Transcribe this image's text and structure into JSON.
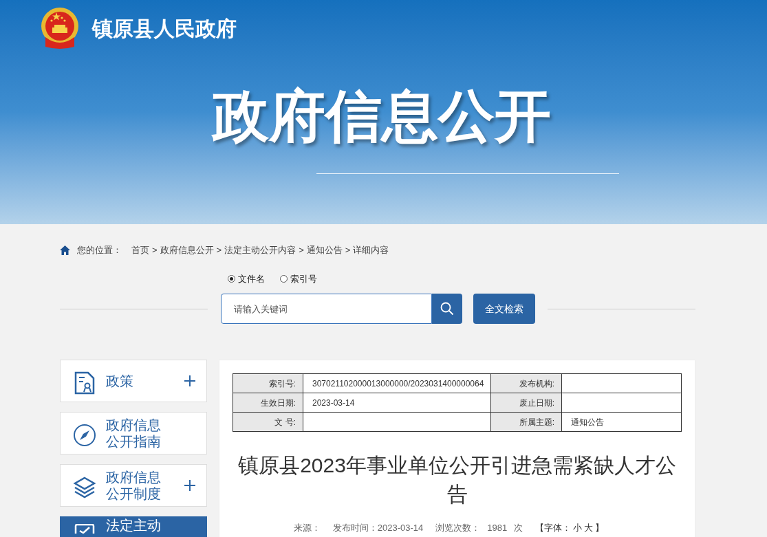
{
  "header": {
    "site_name": "镇原县人民政府",
    "banner_title": "政府信息公开"
  },
  "breadcrumb": {
    "label": "您的位置：",
    "separator": ">",
    "items": [
      "首页",
      "政府信息公开",
      "法定主动公开内容",
      "通知公告",
      "详细内容"
    ]
  },
  "search": {
    "options": [
      {
        "label": "文件名",
        "selected": true
      },
      {
        "label": "索引号",
        "selected": false
      }
    ],
    "placeholder": "请输入关键词",
    "fulltext_button": "全文检索"
  },
  "sidebar": {
    "items": [
      {
        "label": "政策",
        "kind": "certificate",
        "expandable": true,
        "selected": false
      },
      {
        "label": "政府信息公开指南",
        "kind": "compass",
        "expandable": false,
        "selected": false
      },
      {
        "label": "政府信息公开制度",
        "kind": "layers",
        "expandable": true,
        "selected": false
      },
      {
        "label": "法定主动",
        "kind": "checkbox",
        "expandable": false,
        "selected": true
      }
    ]
  },
  "meta_table": {
    "rows": [
      [
        "索引号:",
        "307021102000013000000/2023031400000064",
        "发布机构:",
        ""
      ],
      [
        "生效日期:",
        "2023-03-14",
        "废止日期:",
        ""
      ],
      [
        "文 号:",
        "",
        "所属主题:",
        "通知公告"
      ]
    ]
  },
  "article": {
    "title": "镇原县2023年事业单位公开引进急需紧缺人才公告",
    "source_label": "来源：",
    "publish": "发布时间：2023-03-14",
    "views_label": "浏览次数：",
    "views": "1981",
    "views_unit": "次",
    "font_open": "【字体：",
    "font_small": "小",
    "font_large": "大",
    "font_close": "】"
  }
}
